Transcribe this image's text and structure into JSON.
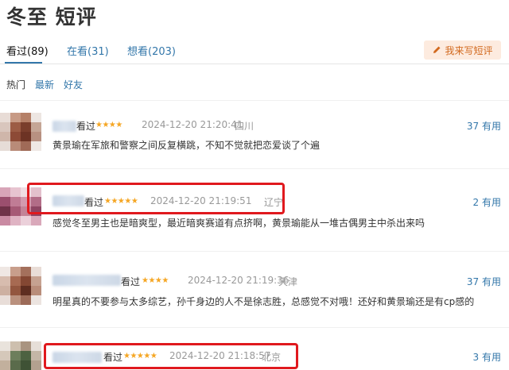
{
  "page_title": "冬至 短评",
  "tabs": [
    {
      "label": "看过(89)"
    },
    {
      "label": "在看(31)"
    },
    {
      "label": "想看(203)"
    }
  ],
  "write_button": {
    "label": "我来写短评",
    "icon": "pencil-icon"
  },
  "sort_options": [
    {
      "label": "热门"
    },
    {
      "label": "最新"
    },
    {
      "label": "好友"
    }
  ],
  "comments": [
    {
      "status": "看过",
      "rating": 4,
      "stars": "★★★★",
      "time": "2024-12-20 21:20:41",
      "location": "四川",
      "useful": "37 有用",
      "text": "黄景瑜在军旅和警察之间反复横跳，不知不觉就把恋爱谈了个遍"
    },
    {
      "status": "看过",
      "rating": 5,
      "stars": "★★★★★",
      "time": "2024-12-20 21:19:51",
      "location": "辽宁",
      "useful": "2 有用",
      "text": "感觉冬至男主也是暗爽型，最近暗爽赛道有点挤啊，黄景瑜能从一堆古偶男主中杀出来吗"
    },
    {
      "status": "看过",
      "rating": 4,
      "stars": "★★★★",
      "time": "2024-12-20 21:19:36",
      "location": "天津",
      "useful": "37 有用",
      "text": "明星真的不要参与太多综艺，孙千身边的人不是徐志胜，总感觉不对哦！还好和黄景瑜还是有cp感的"
    },
    {
      "status": "看过",
      "rating": 5,
      "stars": "★★★★★",
      "time": "2024-12-20 21:18:57",
      "location": "北京",
      "useful": "3 有用",
      "text": ""
    }
  ],
  "colors": {
    "link": "#3377aa",
    "star": "#f5a623",
    "highlight": "#e0191e",
    "button_bg": "#fdebdf",
    "button_text": "#d2691e"
  }
}
